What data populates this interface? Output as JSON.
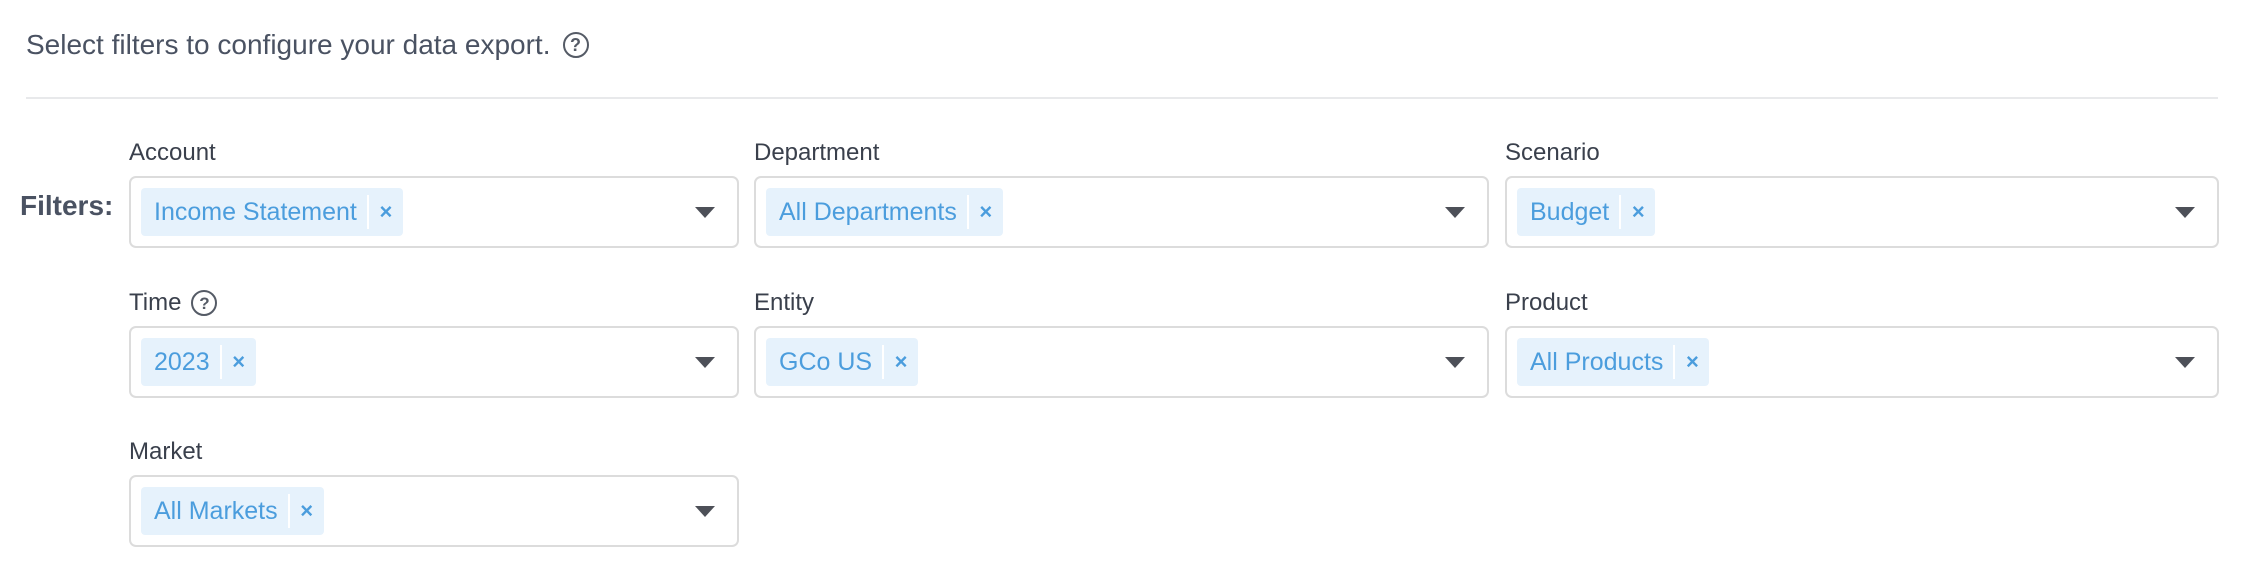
{
  "header": {
    "text": "Select filters to configure your data export.",
    "help_icon": "question-circle-icon"
  },
  "filters_label": "Filters:",
  "colors": {
    "tag_background": "#e6f2fc",
    "tag_text": "#4b9ddd",
    "caret": "#4d5058",
    "border": "#dcdcdc"
  },
  "fields": [
    {
      "label": "Account",
      "has_help": false,
      "selected": [
        "Income Statement"
      ]
    },
    {
      "label": "Department",
      "has_help": false,
      "selected": [
        "All Departments"
      ]
    },
    {
      "label": "Scenario",
      "has_help": false,
      "selected": [
        "Budget"
      ]
    },
    {
      "label": "Time",
      "has_help": true,
      "selected": [
        "2023"
      ]
    },
    {
      "label": "Entity",
      "has_help": false,
      "selected": [
        "GCo US"
      ]
    },
    {
      "label": "Product",
      "has_help": false,
      "selected": [
        "All Products"
      ]
    },
    {
      "label": "Market",
      "has_help": false,
      "selected": [
        "All Markets"
      ]
    }
  ],
  "tag_remove_glyph": "×",
  "help_glyph": "?"
}
